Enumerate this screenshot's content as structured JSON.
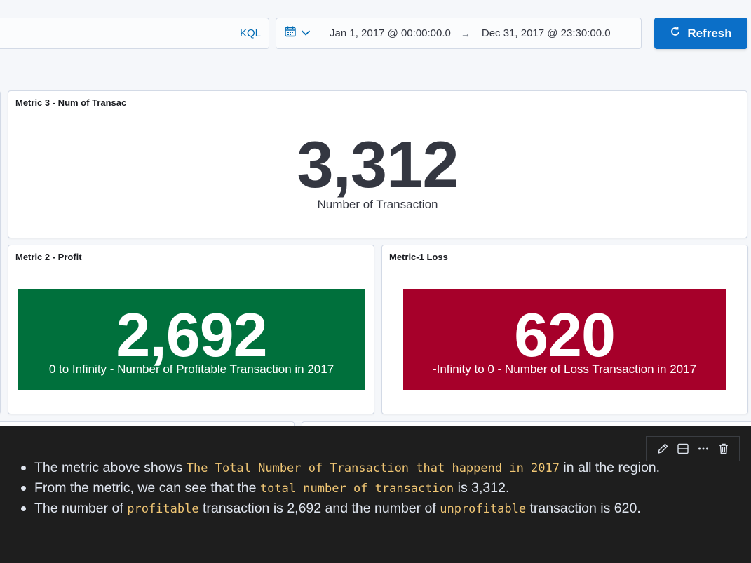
{
  "query_bar": {
    "language": "KQL"
  },
  "date_range": {
    "start": "Jan 1, 2017 @ 00:00:00.0",
    "arrow": "→",
    "end": "Dec 31, 2017 @ 23:30:00.0",
    "calendar_icon": "calendar-icon",
    "chevron_icon": "chevron-down-icon"
  },
  "refresh": {
    "label": "Refresh",
    "icon": "refresh-icon",
    "color": "#0b6fc8"
  },
  "panels": {
    "metric3": {
      "title": "Metric 3 - Num of Transac",
      "value": "3,312",
      "label": "Number of Transaction"
    },
    "metric2": {
      "title": "Metric 2 - Profit",
      "value": "2,692",
      "label": "0 to Infinity - Number of Profitable Transaction in 2017",
      "color": "#00703c"
    },
    "metric1": {
      "title": "Metric-1 Loss",
      "value": "620",
      "label": "-Infinity to 0 - Number of Loss Transaction in 2017",
      "color": "#a6002a"
    }
  },
  "markdown": {
    "toolbar": [
      "pencil-icon",
      "split-panel-icon",
      "more-icon",
      "trash-icon"
    ],
    "lines": [
      {
        "a": "The metric above shows ",
        "code": "The Total Number of Transaction that happend in 2017",
        "b": " in all the region."
      },
      {
        "a": "From the metric, we can see that the ",
        "code": "total number of transaction",
        "b": " is 3,312."
      },
      {
        "a": "The number of ",
        "code": "profitable",
        "b": " transaction is 2,692 and the number of ",
        "code2": "unprofitable",
        "c": " transaction is 620."
      }
    ]
  }
}
